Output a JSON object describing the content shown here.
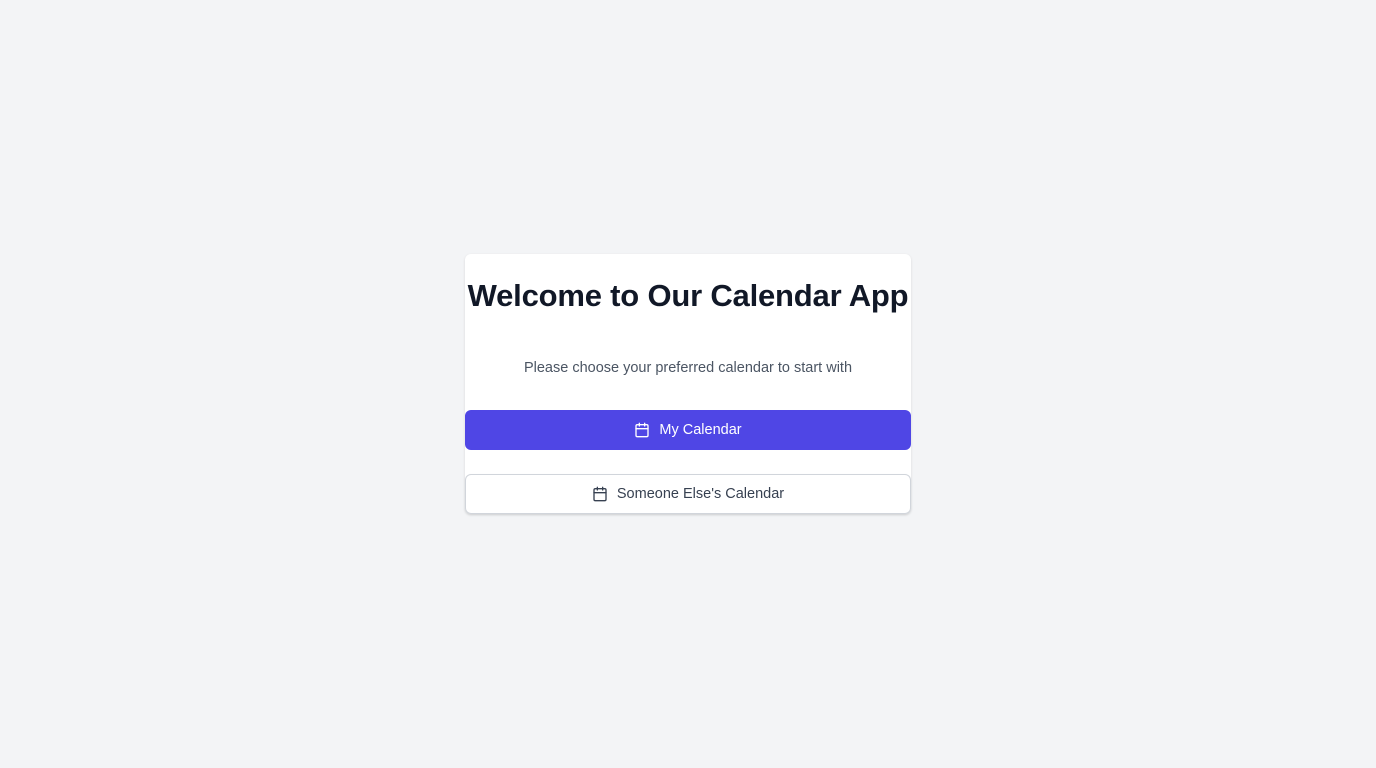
{
  "welcome": {
    "title": "Welcome to Our Calendar App",
    "subtitle": "Please choose your preferred calendar to start with"
  },
  "buttons": {
    "my_calendar": {
      "label": "My Calendar",
      "icon": "calendar-icon"
    },
    "someone_else_calendar": {
      "label": "Someone Else's Calendar",
      "icon": "calendar-icon"
    }
  },
  "colors": {
    "background": "#f3f4f6",
    "primary": "#4f46e5",
    "title": "#111827",
    "subtitle": "#4b5563"
  }
}
